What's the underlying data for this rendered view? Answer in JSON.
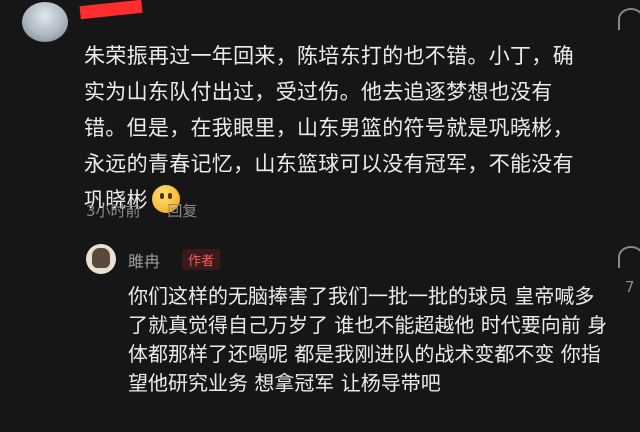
{
  "comment_main": {
    "text": "朱荣振再过一年回来，陈培东打的也不错。小丁，确实为山东队付出过，受过伤。他去追逐梦想也没有错。但是，在我眼里，山东男篮的符号就是巩晓彬，永远的青春记忆，山东篮球可以没有冠军，不能没有巩晓彬",
    "timestamp": "3小时前",
    "reply_label": "回复"
  },
  "reply": {
    "username": "雎冉",
    "badge": "作者",
    "text": "你们这样的无脑捧害了我们一批一批的球员 皇帝喊多了就真觉得自己万岁了 谁也不能超越他 时代要向前 身体都那样了还喝呢 都是我刚进队的战术变都不变 你指望他研究业务 想拿冠军 让杨导带吧",
    "like_count": "7"
  },
  "colors": {
    "background": "#161616",
    "text": "#ececec",
    "meta": "#8a8a8a",
    "author_badge": "#ff5a5a",
    "redaction": "#ff2d2d"
  },
  "icons": {
    "emoji": "laughing-face-emoji",
    "like": "heart-icon"
  }
}
